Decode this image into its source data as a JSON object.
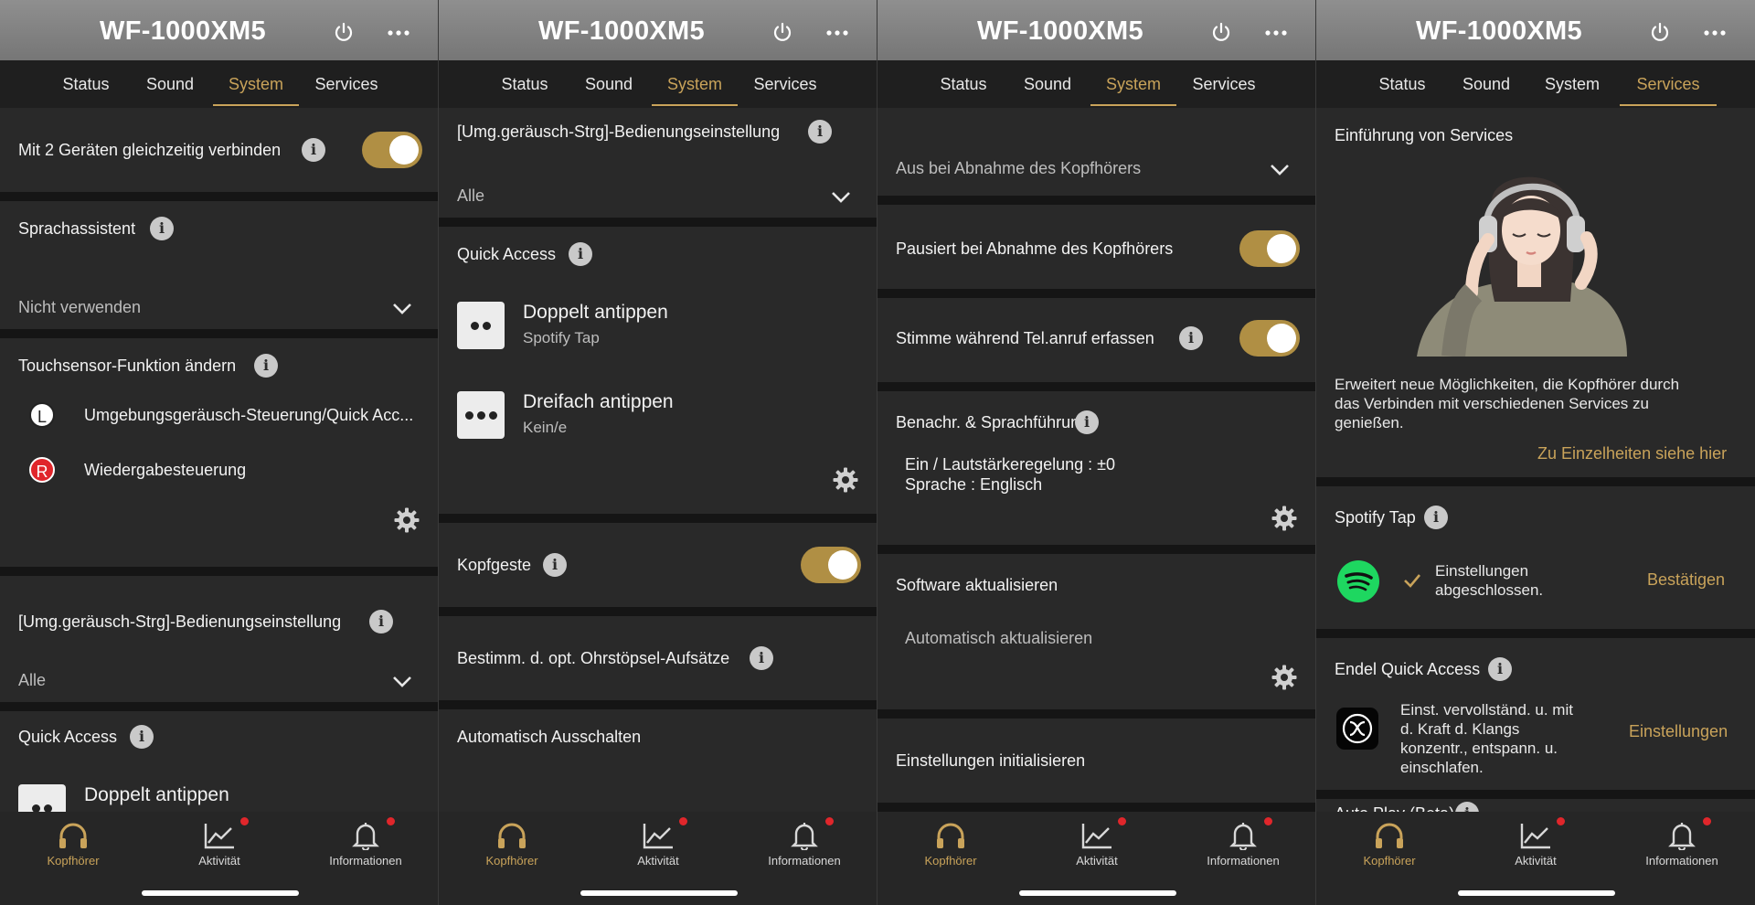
{
  "device_title": "WF-1000XM5",
  "tabs": {
    "status": "Status",
    "sound": "Sound",
    "system": "System",
    "services": "Services"
  },
  "nav": {
    "headphones": "Kopfhörer",
    "activity": "Aktivität",
    "info": "Informationen"
  },
  "colors": {
    "accent": "#c9a35a",
    "toggle_on": "#b08f44",
    "badge": "#e0262b",
    "spotify": "#1ed760"
  },
  "screen1": {
    "multipoint_label": "Mit 2 Geräten gleichzeitig verbinden",
    "multipoint_on": true,
    "voice_assistant_label": "Sprachassistent",
    "voice_assistant_value": "Nicht verwenden",
    "touch_label": "Touchsensor-Funktion ändern",
    "left_letter": "L",
    "left_function": "Umgebungsgeräusch-Steuerung/Quick Acc...",
    "right_letter": "R",
    "right_function": "Wiedergabesteuerung",
    "ambient_label": "[Umg.geräusch-Strg]-Bedienungseinstellung",
    "ambient_value": "Alle",
    "quick_access_label": "Quick Access",
    "double_tap_label": "Doppelt antippen"
  },
  "screen2": {
    "ambient_label": "[Umg.geräusch-Strg]-Bedienungseinstellung",
    "ambient_value": "Alle",
    "quick_access_label": "Quick Access",
    "double_tap_label": "Doppelt antippen",
    "double_tap_value": "Spotify Tap",
    "triple_tap_label": "Dreifach antippen",
    "triple_tap_value": "Kein/e",
    "head_gesture_label": "Kopfgeste",
    "head_gesture_on": true,
    "eartip_label": "Bestimm. d. opt. Ohrstöpsel-Aufsätze",
    "auto_off_label": "Automatisch Ausschalten"
  },
  "screen3": {
    "auto_off_value": "Aus bei Abnahme des Kopfhörers",
    "pause_label": "Pausiert bei Abnahme des Kopfhörers",
    "pause_on": true,
    "capture_voice_label": "Stimme während Tel.anruf erfassen",
    "capture_voice_on": true,
    "notification_label": "Benachr. & Sprachführung",
    "notification_line1": "Ein / Lautstärkeregelung : ±0",
    "notification_line2": "Sprache : Englisch",
    "software_label": "Software aktualisieren",
    "software_value": "Automatisch aktualisieren",
    "reset_label": "Einstellungen initialisieren"
  },
  "screen4": {
    "intro_label": "Einführung von Services",
    "intro_text_1": "Erweitert neue Möglichkeiten, die Kopfhörer durch",
    "intro_text_2": "das Verbinden mit verschiedenen Services zu",
    "intro_text_3": "genießen.",
    "details_link": "Zu Einzelheiten siehe hier",
    "spotify_label": "Spotify Tap",
    "spotify_status_1": "Einstellungen",
    "spotify_status_2": "abgeschlossen.",
    "spotify_action": "Bestätigen",
    "endel_label": "Endel Quick Access",
    "endel_text_1": "Einst. vervollständ. u. mit",
    "endel_text_2": "d. Kraft d. Klangs",
    "endel_text_3": "konzentr., entspann. u.",
    "endel_text_4": "einschlafen.",
    "endel_action": "Einstellungen",
    "autoplay_label": "Auto Play (Beta)"
  }
}
